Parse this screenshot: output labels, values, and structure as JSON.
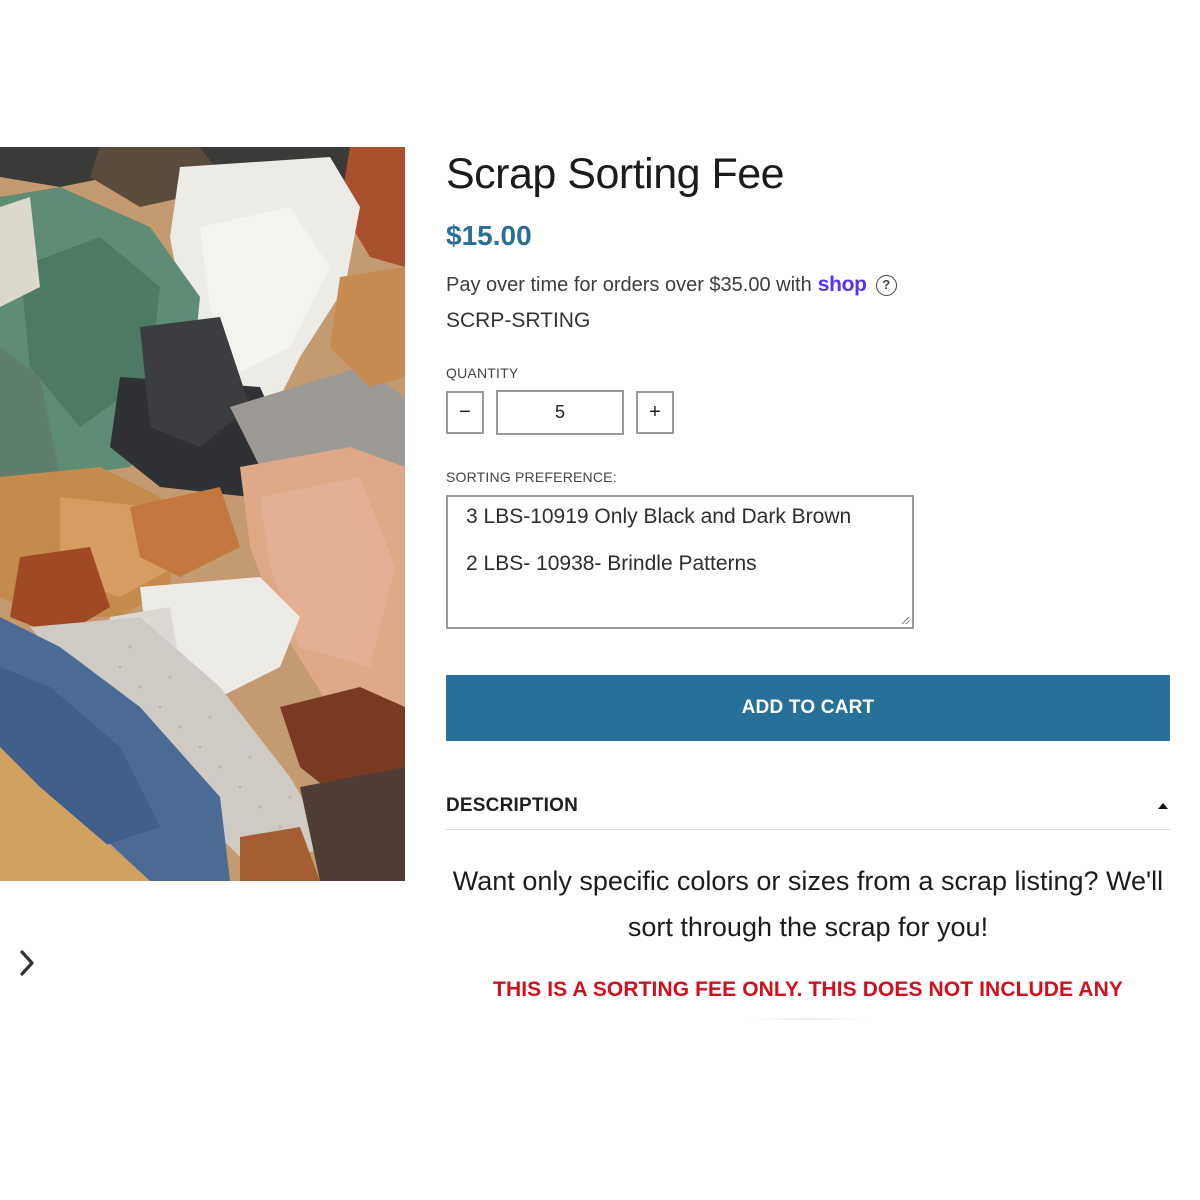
{
  "product": {
    "title": "Scrap Sorting Fee",
    "price": "$15.00",
    "installments_text": "Pay over time for orders over $35.00 with",
    "installments_brand": "shop",
    "help_glyph": "?",
    "sku": "SCRP-SRTING",
    "image_alt": "pile of assorted leather scraps",
    "image_icon": "leather-scraps-photo"
  },
  "quantity": {
    "label": "QUANTITY",
    "value": "5",
    "decrement_label": "−",
    "increment_label": "+"
  },
  "sorting": {
    "label": "SORTING PREFERENCE:",
    "lines": [
      "3 LBS-10919 Only Black and Dark Brown",
      "2 LBS- 10938- Brindle Patterns"
    ]
  },
  "cart": {
    "button_label": "ADD TO CART"
  },
  "description": {
    "header": "DESCRIPTION",
    "body": "Want only specific colors or sizes from a scrap listing? We'll sort through the scrap for you!",
    "warning": "THIS IS A SORTING FEE ONLY. THIS DOES NOT INCLUDE ANY"
  },
  "colors": {
    "price": "#2a6f97",
    "button": "#26709a",
    "shop_brand": "#5a31f4",
    "warning": "#d0111d"
  },
  "icons": {
    "next": "chevron-right-icon",
    "help": "question-circle-icon",
    "collapse": "caret-up-icon"
  }
}
